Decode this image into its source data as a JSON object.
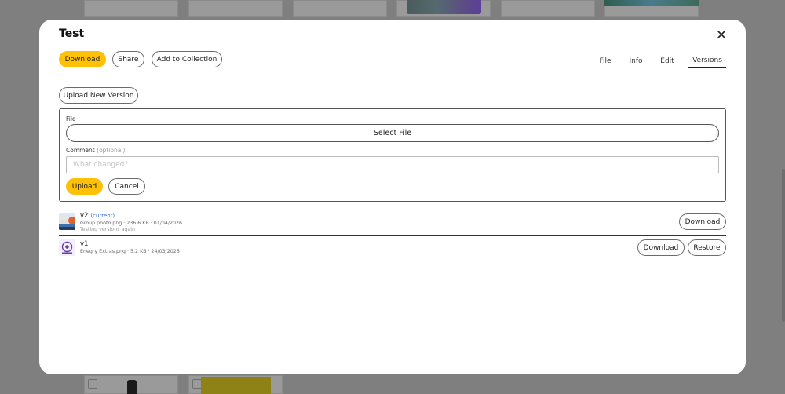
{
  "modal": {
    "title": "Test",
    "actions": {
      "download": "Download",
      "share": "Share",
      "add_to_collection": "Add to Collection"
    },
    "tabs": [
      {
        "label": "File",
        "active": false
      },
      {
        "label": "Info",
        "active": false
      },
      {
        "label": "Edit",
        "active": false
      },
      {
        "label": "Versions",
        "active": true
      }
    ],
    "upload_new_version": "Upload New Version",
    "form": {
      "file_label": "File",
      "select_file": "Select File",
      "comment_label": "Comment",
      "comment_optional": "(optional)",
      "comment_placeholder": "What changed?",
      "comment_value": "",
      "upload": "Upload",
      "cancel": "Cancel"
    },
    "versions": [
      {
        "name": "v2",
        "badge": "(current)",
        "meta": "Group photo.png · 236.6 KB · 01/04/2026",
        "note": "Testing versions again",
        "buttons": {
          "download": "Download"
        }
      },
      {
        "name": "v1",
        "badge": "",
        "meta": "Enegry Extras.png · 5.2 KB · 24/03/2026",
        "note": "",
        "buttons": {
          "download": "Download",
          "restore": "Restore"
        }
      }
    ]
  },
  "colors": {
    "accent": "#ffc107",
    "current_badge": "#3b6fd1",
    "overlay": "#7f7f7f"
  }
}
